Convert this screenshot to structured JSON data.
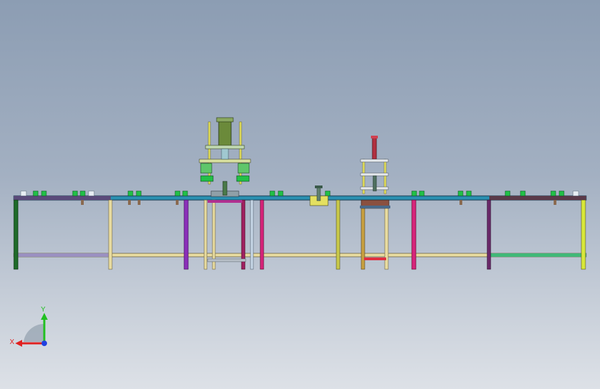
{
  "viewport": {
    "title": "",
    "background_top": "#8c9db3",
    "background_bottom": "#dde1e7"
  },
  "model": {
    "description_visible": false,
    "assembly": "conveyor-line-with-two-press-stations",
    "colors": {
      "frame_top": "#2a8fb0",
      "frame_dark": "#3a3a55",
      "leg_green_dark": "#1f6b2a",
      "leg_cream": "#e8dca0",
      "leg_purple": "#8a2fb8",
      "leg_magenta": "#d6247a",
      "leg_yellow": "#c9c94a",
      "leg_lime": "#d8e83a",
      "leg_gold": "#c8a040",
      "cylinder_green": "#5fc66a",
      "cylinder_olive": "#6b8a3a",
      "cylinder_red": "#b03040",
      "station_yellow": "#e4e060",
      "block_green": "#22c048"
    }
  },
  "triad": {
    "x_label": "X",
    "y_label": "Y",
    "x_color": "#e02020",
    "y_color": "#20c020",
    "z_color": "#2040e0"
  }
}
